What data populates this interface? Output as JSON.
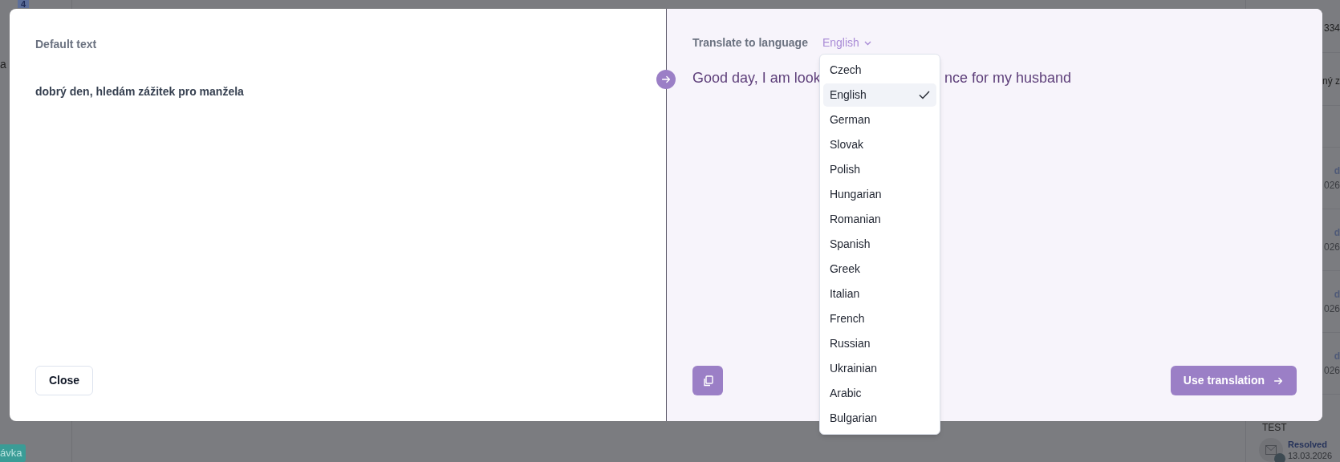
{
  "background": {
    "left": {
      "badge": "4",
      "text": "a",
      "tag": "ávka"
    },
    "right": {
      "items": [
        {
          "text": "334"
        },
        {
          "text": "ný z"
        }
      ],
      "rows": [
        {
          "status": "d",
          "date": "026"
        },
        {
          "status": "d",
          "date": "026"
        },
        {
          "status": "d",
          "date": "026"
        },
        {
          "status": "d",
          "date": "026"
        }
      ],
      "title": "TEST",
      "status": "Resolved",
      "date": "13.03.2026"
    }
  },
  "modal": {
    "source": {
      "label": "Default text",
      "text": "dobrý den, hledám zážitek pro manžela",
      "close": "Close"
    },
    "target": {
      "label": "Translate to language",
      "language": "English",
      "text_parts": [
        "Good day, I am look",
        "nce for my husband"
      ],
      "use": "Use translation",
      "dropdown": {
        "options": [
          {
            "label": "Czech",
            "selected": false
          },
          {
            "label": "English",
            "selected": true
          },
          {
            "label": "German",
            "selected": false
          },
          {
            "label": "Slovak",
            "selected": false
          },
          {
            "label": "Polish",
            "selected": false
          },
          {
            "label": "Hungarian",
            "selected": false
          },
          {
            "label": "Romanian",
            "selected": false
          },
          {
            "label": "Spanish",
            "selected": false
          },
          {
            "label": "Greek",
            "selected": false
          },
          {
            "label": "Italian",
            "selected": false
          },
          {
            "label": "French",
            "selected": false
          },
          {
            "label": "Russian",
            "selected": false
          },
          {
            "label": "Ukrainian",
            "selected": false
          },
          {
            "label": "Arabic",
            "selected": false
          },
          {
            "label": "Bulgarian",
            "selected": false
          }
        ]
      }
    }
  }
}
